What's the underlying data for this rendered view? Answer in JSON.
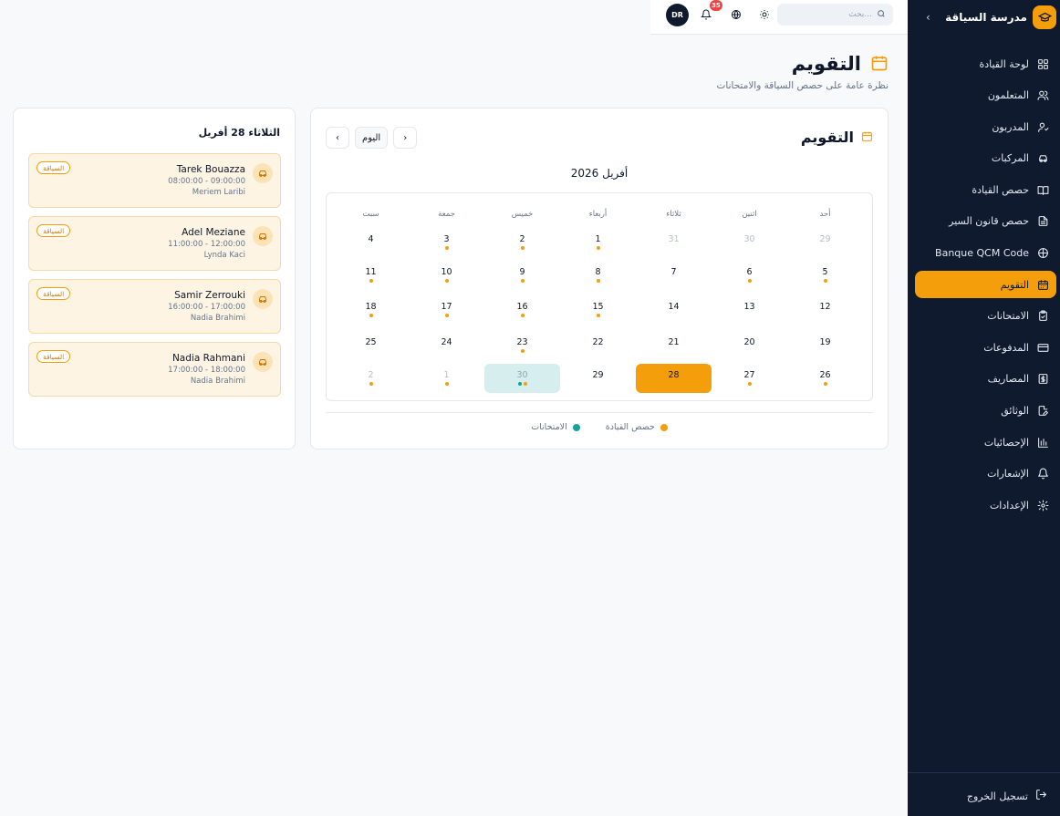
{
  "sidebar": {
    "brand": "مدرسة السياقة",
    "items": [
      {
        "label": "لوحة القيادة",
        "icon": "dashboard-icon"
      },
      {
        "label": "المتعلمون",
        "icon": "users-icon"
      },
      {
        "label": "المدربون",
        "icon": "instructor-icon"
      },
      {
        "label": "المركبات",
        "icon": "car-icon"
      },
      {
        "label": "حصص القيادة",
        "icon": "book-icon"
      },
      {
        "label": "حصص قانون السير",
        "icon": "document-icon"
      },
      {
        "label": "Banque QCM Code",
        "icon": "globe-icon"
      },
      {
        "label": "التقويم",
        "icon": "calendar-icon",
        "active": true
      },
      {
        "label": "الامتحانات",
        "icon": "clipboard-check-icon"
      },
      {
        "label": "المدفوعات",
        "icon": "credit-card-icon"
      },
      {
        "label": "المصاريف",
        "icon": "dollar-icon"
      },
      {
        "label": "الوثائق",
        "icon": "file-edit-icon"
      },
      {
        "label": "الإحصائيات",
        "icon": "bar-chart-icon"
      },
      {
        "label": "الإشعارات",
        "icon": "bell-icon"
      },
      {
        "label": "الإعدادات",
        "icon": "gear-icon"
      }
    ],
    "logout": "تسجيل الخروج"
  },
  "topbar": {
    "search_placeholder": "بحث...",
    "notif_count": "35",
    "avatar": "DR"
  },
  "page": {
    "title": "التقويم",
    "subtitle": "نظرة عامة على حصص السياقة والامتحانات"
  },
  "calendar": {
    "title": "التقويم",
    "today_label": "اليوم",
    "month": "أفريل 2026",
    "weekdays": [
      "أحد",
      "اثنين",
      "ثلاثاء",
      "أربعاء",
      "خميس",
      "جمعة",
      "سبت"
    ],
    "weeks": [
      [
        {
          "d": "29",
          "m": 1,
          "o": 0,
          "t": 0
        },
        {
          "d": "30",
          "m": 1,
          "o": 0,
          "t": 0
        },
        {
          "d": "31",
          "m": 1,
          "o": 0,
          "t": 0
        },
        {
          "d": "1",
          "m": 0,
          "o": 1,
          "t": 0
        },
        {
          "d": "2",
          "m": 0,
          "o": 1,
          "t": 0
        },
        {
          "d": "3",
          "m": 0,
          "o": 1,
          "t": 0
        },
        {
          "d": "4",
          "m": 0,
          "o": 0,
          "t": 0
        }
      ],
      [
        {
          "d": "5",
          "m": 0,
          "o": 1,
          "t": 0
        },
        {
          "d": "6",
          "m": 0,
          "o": 1,
          "t": 0
        },
        {
          "d": "7",
          "m": 0,
          "o": 0,
          "t": 0
        },
        {
          "d": "8",
          "m": 0,
          "o": 1,
          "t": 0
        },
        {
          "d": "9",
          "m": 0,
          "o": 1,
          "t": 0
        },
        {
          "d": "10",
          "m": 0,
          "o": 1,
          "t": 0
        },
        {
          "d": "11",
          "m": 0,
          "o": 1,
          "t": 0
        }
      ],
      [
        {
          "d": "12",
          "m": 0,
          "o": 0,
          "t": 0
        },
        {
          "d": "13",
          "m": 0,
          "o": 0,
          "t": 0
        },
        {
          "d": "14",
          "m": 0,
          "o": 0,
          "t": 0
        },
        {
          "d": "15",
          "m": 0,
          "o": 1,
          "t": 0
        },
        {
          "d": "16",
          "m": 0,
          "o": 1,
          "t": 0
        },
        {
          "d": "17",
          "m": 0,
          "o": 1,
          "t": 0
        },
        {
          "d": "18",
          "m": 0,
          "o": 1,
          "t": 0
        }
      ],
      [
        {
          "d": "19",
          "m": 0,
          "o": 0,
          "t": 0
        },
        {
          "d": "20",
          "m": 0,
          "o": 0,
          "t": 0
        },
        {
          "d": "21",
          "m": 0,
          "o": 0,
          "t": 0
        },
        {
          "d": "22",
          "m": 0,
          "o": 0,
          "t": 0
        },
        {
          "d": "23",
          "m": 0,
          "o": 1,
          "t": 0
        },
        {
          "d": "24",
          "m": 0,
          "o": 0,
          "t": 0
        },
        {
          "d": "25",
          "m": 0,
          "o": 0,
          "t": 0
        }
      ],
      [
        {
          "d": "26",
          "m": 0,
          "o": 1,
          "t": 0
        },
        {
          "d": "27",
          "m": 0,
          "o": 1,
          "t": 0
        },
        {
          "d": "28",
          "m": 0,
          "o": 0,
          "t": 0,
          "selected": true
        },
        {
          "d": "29",
          "m": 0,
          "o": 0,
          "t": 0
        },
        {
          "d": "30",
          "m": 0,
          "o": 1,
          "t": 1,
          "today": true
        },
        {
          "d": "1",
          "m": 1,
          "o": 1,
          "t": 0
        },
        {
          "d": "2",
          "m": 1,
          "o": 1,
          "t": 0
        }
      ]
    ],
    "legend": [
      {
        "label": "حصص القيادة",
        "color": "#f59e0b"
      },
      {
        "label": "الامتحانات",
        "color": "#14a39a"
      }
    ]
  },
  "day_panel": {
    "title": "الثلاثاء 28 أفريل",
    "events": [
      {
        "name": "Tarek Bouazza",
        "time": "08:00:00 - 09:00:00",
        "instructor": "Meriem Laribi",
        "tag": "السياقة"
      },
      {
        "name": "Adel Meziane",
        "time": "11:00:00 - 12:00:00",
        "instructor": "Lynda Kaci",
        "tag": "السياقة"
      },
      {
        "name": "Samir Zerrouki",
        "time": "16:00:00 - 17:00:00",
        "instructor": "Nadia Brahimi",
        "tag": "السياقة"
      },
      {
        "name": "Nadia Rahmani",
        "time": "17:00:00 - 18:00:00",
        "instructor": "Nadia Brahimi",
        "tag": "السياقة"
      }
    ]
  },
  "colors": {
    "accent": "#f59e0b",
    "exam": "#14a39a",
    "sidebar_bg": "#101a2e",
    "today_bg": "#d6efee"
  }
}
